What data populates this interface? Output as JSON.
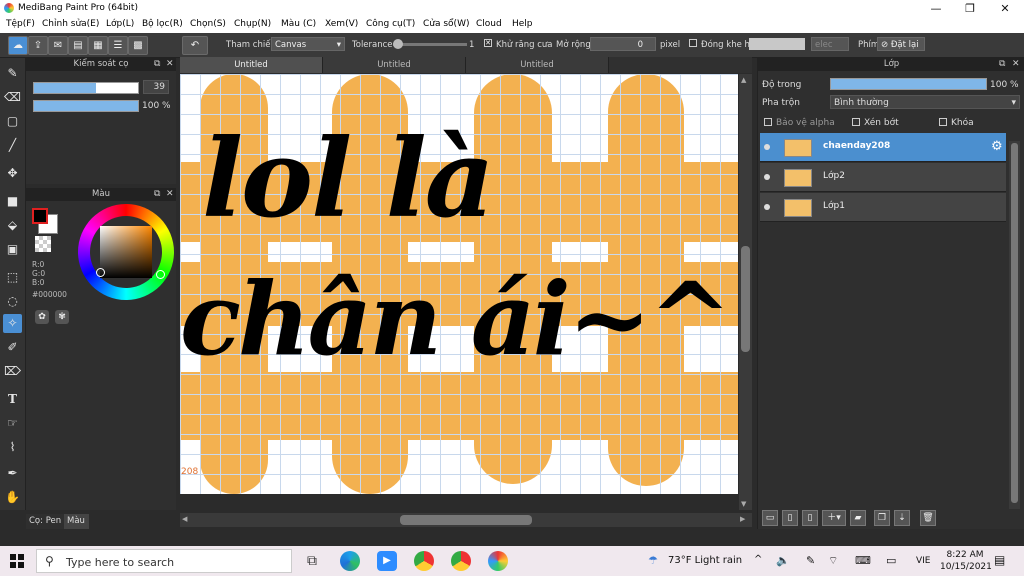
{
  "window": {
    "title": "MediBang Paint Pro (64bit)"
  },
  "menu": [
    "Tệp(F)",
    "Chỉnh sửa(E)",
    "Lớp(L)",
    "Bộ lọc(R)",
    "Chọn(S)",
    "Chụp(N)",
    "Màu (C)",
    "Xem(V)",
    "Công cụ(T)",
    "Cửa sổ(W)",
    "Cloud",
    "Help"
  ],
  "toolbar": {
    "reference_label": "Tham chiếu",
    "reference_value": "Canvas",
    "tolerance_label": "Tolerance",
    "tolerance_value": "1",
    "antialias_label": "Khử răng cưa",
    "expand_label": "Mở rộng",
    "expand_value": "0",
    "expand_unit": "pixel",
    "gap_label": "Đóng khe hở",
    "select_label": "elec",
    "key_label": "Phím",
    "reset_label": "Đặt lại"
  },
  "brush_panel": {
    "title": "Kiểm soát cọ",
    "size": "39",
    "opacity": "100 %",
    "size_fraction": 0.6,
    "opacity_fraction": 1.0
  },
  "color_panel": {
    "title": "Màu",
    "r": "R:0",
    "g": "G:0",
    "b": "B:0",
    "hex": "#000000"
  },
  "left_bottom_tabs": [
    "Cọ: Pen",
    "Màu"
  ],
  "canvas": {
    "tabs": [
      "Untitled",
      "Untitled",
      "Untitled"
    ],
    "text_line1": "lol là",
    "text_line2": "chân ái~^",
    "corner_text": "208",
    "fill_color": "#f3b150"
  },
  "layer_panel": {
    "title": "Lớp",
    "opacity_label": "Độ trong",
    "opacity_value": "100 %",
    "opacity_fraction": 1.0,
    "blend_label": "Pha trộn",
    "blend_value": "Bình thường",
    "protect_alpha": "Bảo vệ alpha",
    "clipping": "Xén bớt",
    "lock": "Khóa",
    "layers": [
      {
        "name": "chaenday208",
        "selected": true
      },
      {
        "name": "Lớp2",
        "selected": false
      },
      {
        "name": "Lớp1",
        "selected": false
      }
    ]
  },
  "taskbar": {
    "search_placeholder": "Type here to search",
    "weather": "73°F  Light rain",
    "language": "VIE",
    "time": "8:22 AM",
    "date": "10/15/2021"
  }
}
